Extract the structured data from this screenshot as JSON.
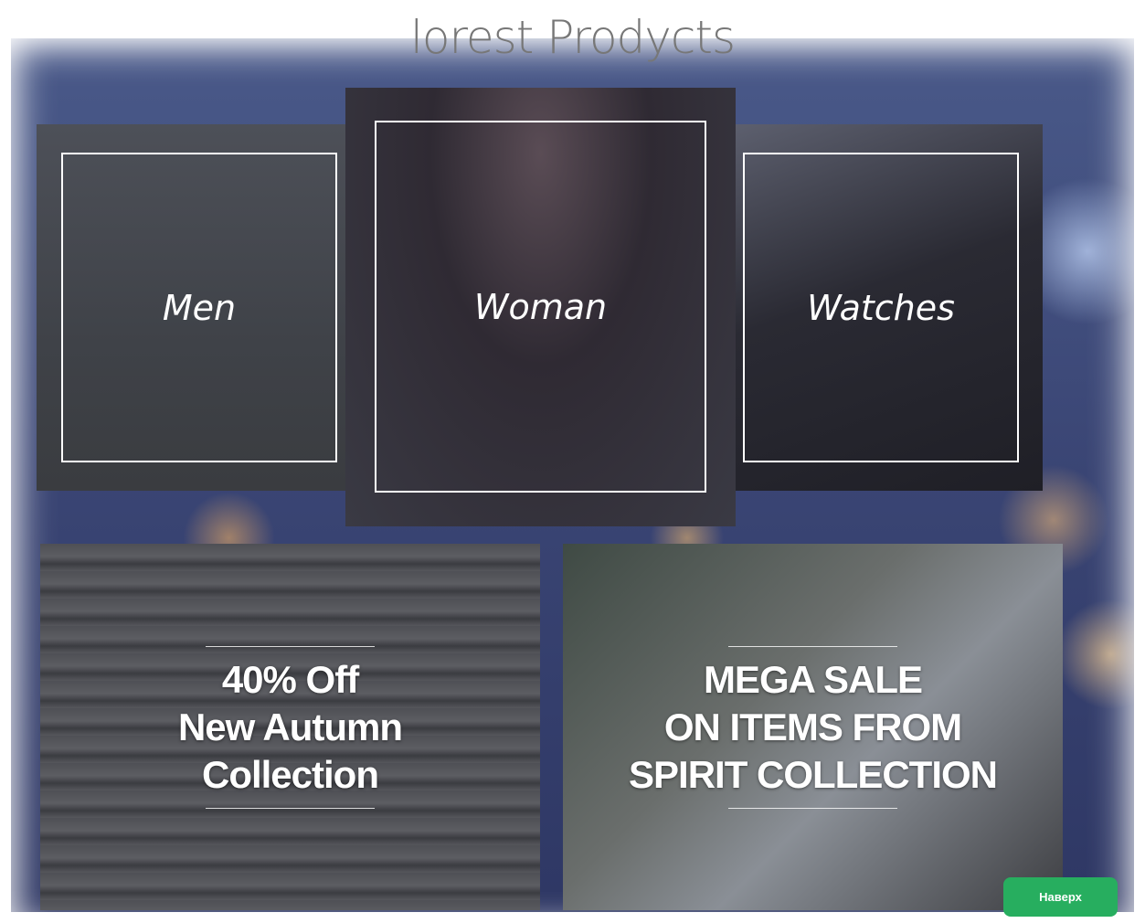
{
  "title": "lorest Prodycts",
  "categories": [
    {
      "label": "Men"
    },
    {
      "label": "Woman"
    },
    {
      "label": "Watches"
    }
  ],
  "promos": [
    {
      "lines": [
        "40% Off",
        "New Autumn",
        "Collection"
      ]
    },
    {
      "lines": [
        "MEGA SALE",
        "ON ITEMS FROM",
        "SPIRIT COLLECTION"
      ]
    }
  ],
  "back_to_top": "Наверх",
  "colors": {
    "accent": "#27ae5f",
    "title": "#777777"
  }
}
